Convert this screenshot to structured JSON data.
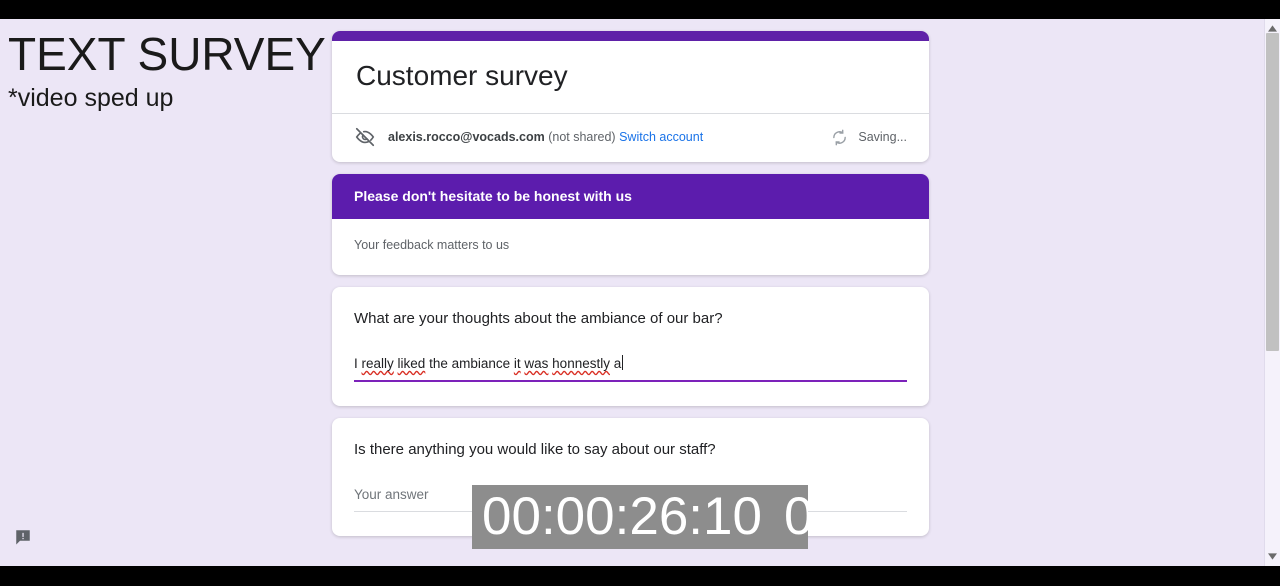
{
  "caption": {
    "title": "TEXT SURVEY",
    "subtitle": "*video sped up"
  },
  "colors": {
    "accent_purple": "#5f21a8",
    "section_purple": "#5c1cad",
    "page_background": "#ece6f6",
    "link_blue": "#1a73e8",
    "answer_underline": "#7c22ba",
    "spellcheck_red": "#d93025",
    "timer_background": "#8d8d8d"
  },
  "form": {
    "title": "Customer survey",
    "account": {
      "visibility_icon": "eye-off-icon",
      "email": "alexis.rocco@vocads.com",
      "shared_state": "(not shared)",
      "switch_account_label": "Switch account"
    },
    "status": {
      "icon": "sync-icon",
      "text": "Saving..."
    },
    "section": {
      "title": "Please don't hesitate to be honest with us",
      "description": "Your feedback matters to us"
    },
    "questions": [
      {
        "title": "What are your thoughts about the ambiance of our bar?",
        "answer_value": "I really liked the ambiance it was honnestly a",
        "answer_placeholder": "Your answer",
        "focused": true,
        "answer_tokens": [
          {
            "text": "I ",
            "misspelled": false
          },
          {
            "text": "really",
            "misspelled": true
          },
          {
            "text": " ",
            "misspelled": false
          },
          {
            "text": "liked",
            "misspelled": true
          },
          {
            "text": " the ambiance ",
            "misspelled": false
          },
          {
            "text": "it",
            "misspelled": true
          },
          {
            "text": " ",
            "misspelled": false
          },
          {
            "text": "was",
            "misspelled": true
          },
          {
            "text": " ",
            "misspelled": false
          },
          {
            "text": "honnestly",
            "misspelled": true
          },
          {
            "text": " a",
            "misspelled": false
          }
        ]
      },
      {
        "title": "Is there anything you would like to say about our staff?",
        "answer_value": "",
        "answer_placeholder": "Your answer",
        "focused": false
      }
    ]
  },
  "timer": {
    "value": "00:00:26:10",
    "partial_digit": "0"
  },
  "feedback": {
    "icon": "feedback-report-icon"
  },
  "scrollbar": {
    "up_arrow_icon": "chevron-up-icon",
    "down_arrow_icon": "chevron-down-icon"
  }
}
